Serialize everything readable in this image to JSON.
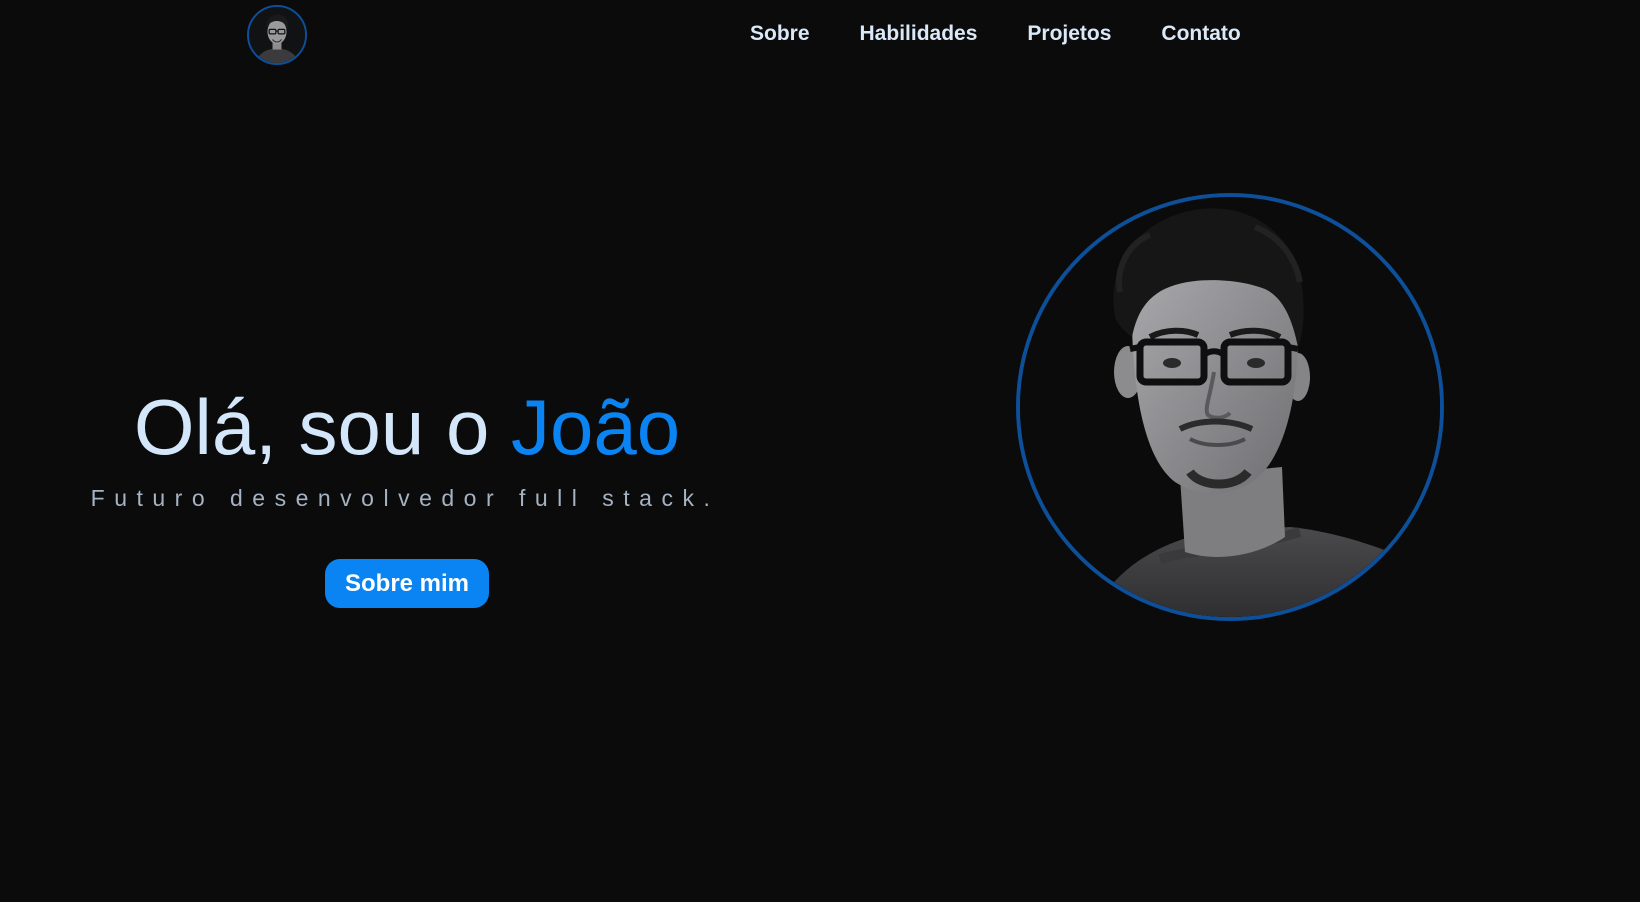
{
  "nav": {
    "logo_icon": "profile-avatar-icon",
    "links": [
      {
        "label": "Sobre"
      },
      {
        "label": "Habilidades"
      },
      {
        "label": "Projetos"
      },
      {
        "label": "Contato"
      }
    ]
  },
  "hero": {
    "greeting": "Olá, sou o",
    "name": "João",
    "subtitle": "Futuro desenvolvedor full stack.",
    "button_label": "Sobre mim",
    "photo_icon": "profile-photo"
  },
  "colors": {
    "background": "#0b0b0c",
    "accent": "#0b84f3",
    "ring": "#0d4f98",
    "text_primary": "#d4e6fa",
    "text_secondary": "#a5b3c2"
  }
}
